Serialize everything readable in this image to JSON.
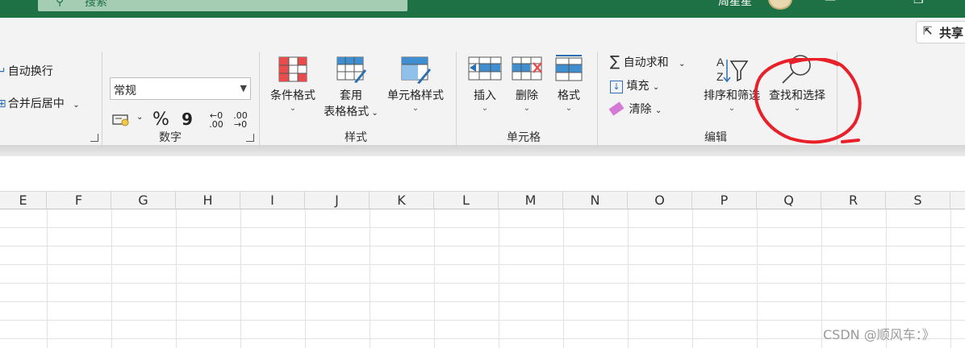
{
  "titlebar": {
    "search_placeholder": "搜索",
    "user_name": "周星星"
  },
  "share": {
    "label": "共享",
    "icon": "share-icon"
  },
  "alignment": {
    "wrap_text": "自动换行",
    "merge_center": "合并后居中"
  },
  "number": {
    "format_value": "常规",
    "group_label": "数字",
    "percent_symbol": "%",
    "comma_symbol": "9",
    "inc_decimal": "←0 .00",
    "dec_decimal": ".00 →0"
  },
  "styles": {
    "conditional_format": "条件格式",
    "format_table_1": "套用",
    "format_table_2": "表格格式",
    "cell_styles": "单元格样式",
    "group_label": "样式"
  },
  "cells": {
    "insert": "插入",
    "delete": "删除",
    "format": "格式",
    "group_label": "单元格"
  },
  "editing": {
    "autosum": "自动求和",
    "fill": "填充",
    "clear": "清除",
    "sort_filter": "排序和筛选",
    "find_select": "查找和选择",
    "group_label": "编辑"
  },
  "grid": {
    "columns": [
      "E",
      "F",
      "G",
      "H",
      "I",
      "J",
      "K",
      "L",
      "M",
      "N",
      "O",
      "P",
      "Q",
      "R",
      "S"
    ]
  },
  "watermark": "CSDN @顺风车：》",
  "colors": {
    "title_green": "#1e7145",
    "annotation_red": "#e8202a",
    "icon_blue": "#2b6fb5",
    "icon_red": "#e84d4d"
  }
}
